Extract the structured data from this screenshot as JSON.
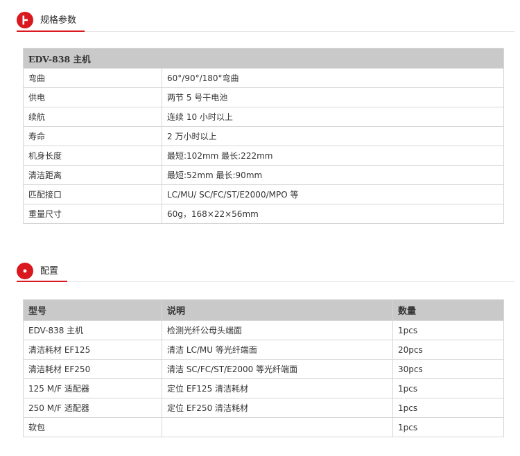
{
  "spec_section": {
    "title": "规格参数"
  },
  "spec_table": {
    "header": "EDV-838 主机",
    "rows": [
      {
        "label": "弯曲",
        "value": "60°/90°/180°弯曲"
      },
      {
        "label": "供电",
        "value": "两节 5 号干电池"
      },
      {
        "label": "续航",
        "value": "连续 10 小时以上"
      },
      {
        "label": "寿命",
        "value": "2 万小时以上"
      },
      {
        "label": "机身长度",
        "value": "最短:102mm  最长:222mm"
      },
      {
        "label": "清洁距离",
        "value": "最短:52mm  最长:90mm"
      },
      {
        "label": "匹配接口",
        "value": "LC/MU/ SC/FC/ST/E2000/MPO 等"
      },
      {
        "label": "重量尺寸",
        "value": "60g，168×22×56mm"
      }
    ]
  },
  "config_section": {
    "title": "配置"
  },
  "config_table": {
    "headers": {
      "model": "型号",
      "description": "说明",
      "quantity": "数量"
    },
    "rows": [
      {
        "model": "EDV-838 主机",
        "description": "检测光纤公母头端面",
        "quantity": "1pcs"
      },
      {
        "model": "清洁耗材 EF125",
        "description": "清洁 LC/MU 等光纤端面",
        "quantity": "20pcs"
      },
      {
        "model": "清洁耗材 EF250",
        "description": "清洁 SC/FC/ST/E2000 等光纤端面",
        "quantity": "30pcs"
      },
      {
        "model": "125 M/F 适配器",
        "description": "定位 EF125 清洁耗材",
        "quantity": "1pcs"
      },
      {
        "model": "250 M/F 适配器",
        "description": "定位 EF250 清洁耗材",
        "quantity": "1pcs"
      },
      {
        "model": "软包",
        "description": "",
        "quantity": "1pcs"
      }
    ]
  },
  "colors": {
    "accent": "#d9191f",
    "header_bg": "#c9c9c9",
    "border": "#d6d6d6"
  }
}
